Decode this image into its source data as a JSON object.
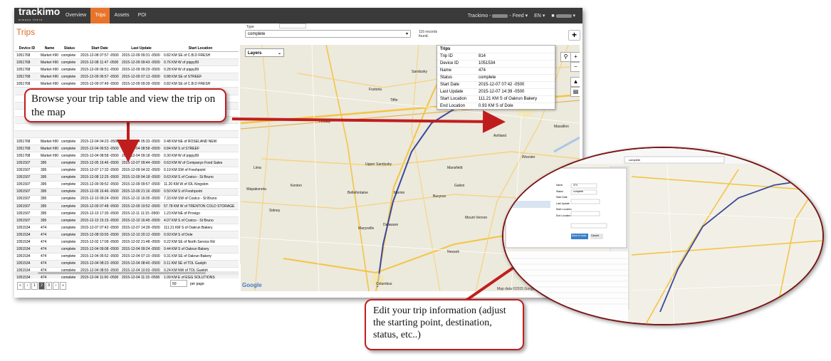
{
  "app": {
    "logo": "trackimo",
    "logo_sub": "always there",
    "nav": [
      "Overview",
      "Trips",
      "Assets",
      "POI"
    ],
    "active_nav": "Trips",
    "right_brand": "Trackimo",
    "feed_label": "Feed",
    "lang_label": "EN",
    "accent_color": "#e8742b"
  },
  "page": {
    "title": "Trips",
    "type_label": "Type",
    "status_select": "complete",
    "records": [
      "116 records",
      "found."
    ],
    "add_icon": "plus-icon"
  },
  "table": {
    "headers": [
      "Device ID",
      "Name",
      "Status",
      "Start Date",
      "Last Update",
      "Start Location"
    ],
    "rows": [
      [
        "1051768",
        "Market #90",
        "complete",
        "2015-12-08 07:57 -0500",
        "2015-12-09 09:31 -0500",
        "0.82 KM SE of C.B.D FRESH"
      ],
      [
        "1051768",
        "Market #90",
        "complete",
        "2015-12-08 11:47 -0500",
        "2015-12-09 09:43 -0500",
        "0.76 KM W of pippy99"
      ],
      [
        "1051768",
        "Market #90",
        "complete",
        "2015-12-09 06:51 -0500",
        "2015-12-09 09:29 -0500",
        "0.28 KM W of pippy99"
      ],
      [
        "1051768",
        "Market #90",
        "complete",
        "2015-12-09 06:57 -0500",
        "2015-12-09 07:13 -0500",
        "0.88 KM SE of STREEF"
      ],
      [
        "1051768",
        "Market #90",
        "complete",
        "2015-12-09 07:49 -0500",
        "2015-12-09 09:39 -0500",
        "0.82 KM SE of C.B.D FRESH"
      ],
      [
        "",
        "",
        "",
        "",
        "",
        ""
      ],
      [
        "",
        "",
        "",
        "",
        "",
        ""
      ],
      [
        "",
        "",
        "",
        "",
        "",
        ""
      ],
      [
        "",
        "",
        "",
        "",
        "",
        ""
      ],
      [
        "",
        "",
        "",
        "",
        "",
        ""
      ],
      [
        "",
        "",
        "",
        "",
        "",
        ""
      ],
      [
        "",
        "",
        "",
        "",
        "",
        ""
      ],
      [
        "1051768",
        "Market #90",
        "complete",
        "2015-12-04 04:23 -0500",
        "2015-12-04 05:33 -0500",
        "0.48 KM NE of ROSELAND NEW"
      ],
      [
        "1051768",
        "Market #90",
        "complete",
        "2015-12-04 06:53 -0500",
        "2015-12-04 08:58 -0500",
        "0.84 KM S of STREEF"
      ],
      [
        "1051768",
        "Market #90",
        "complete",
        "2015-12-04 08:58 -0500",
        "2015-12-04 09:18 -0500",
        "0.30 KM W of pippy99"
      ],
      [
        "1051507",
        "395",
        "complete",
        "2015-12-05 16:46 -0500",
        "2015-12-07 09:44 -0500",
        "0.63 KM W of Companys Food Sales"
      ],
      [
        "1051507",
        "395",
        "complete",
        "2015-12-07 17:32 -0500",
        "2015-12-09 04:32 -0500",
        "0.19 KM SW of Freshpoint"
      ],
      [
        "1051507",
        "395",
        "complete",
        "2015-12-08 12:25 -0500",
        "2015-12-09 04:18 -0500",
        "0.63 KM S of Costco - St Bruno"
      ],
      [
        "1051507",
        "395",
        "complete",
        "2015-12-09 09:52 -0500",
        "2015-12-09 09:57 -0500",
        "11.20 KM W of IDL Kingston"
      ],
      [
        "1051507",
        "395",
        "complete",
        "2015-12-09 16:46 -0500",
        "2015-12-09 21:16 -0500",
        "0.50 KM S of Freshpoint"
      ],
      [
        "1051507",
        "395",
        "complete",
        "2015-12-10 09:24 -0500",
        "2015-12-10 16:05 -0500",
        "7.33 KM SW of Costco - St Bruno"
      ],
      [
        "1051507",
        "395",
        "complete",
        "2015-12-09 07:48 -0500",
        "2015-12-09 19:52 -0500",
        "57.78 KM W of TRENTON COLD STORAGE"
      ],
      [
        "1051507",
        "395",
        "complete",
        "2015-12-10 17:30 -0500",
        "2015-12-11 11:15 -0500",
        "1.23 KM NE of Provigo"
      ],
      [
        "1051507",
        "395",
        "complete",
        "2015-12-10 15:15 -0500",
        "2015-12-10 16:45 -0500",
        "4.07 KM S of Costco - St Bruno"
      ],
      [
        "1051534",
        "474",
        "complete",
        "2015-12-07 07:42 -0500",
        "2015-12-07 14:39 -0500",
        "111.21 KM S of Oakrun Bakery"
      ],
      [
        "1051534",
        "474",
        "complete",
        "2015-12-08 03:55 -0500",
        "2015-12-10 20:12 -0500",
        "0.93 KM S of Dole"
      ],
      [
        "1051534",
        "474",
        "complete",
        "2015-12-02 17:09 -0500",
        "2015-12-02 21:48 -0500",
        "0.22 KM SE of North Service Rd"
      ],
      [
        "1051534",
        "474",
        "complete",
        "2015-12-04 09:08 -0500",
        "2015-12-04 09:24 -0500",
        "0.44 KM S of Oakrun Bakery"
      ],
      [
        "1051534",
        "474",
        "complete",
        "2015-12-04 05:52 -0500",
        "2015-12-04 07:10 -0500",
        "0.31 KM SE of Oakrun Bakery"
      ],
      [
        "1051534",
        "474",
        "complete",
        "2015-12-04 08:23 -0500",
        "2015-12-04 08:40 -0500",
        "0.11 KM SE of TDL Guelph"
      ],
      [
        "1051534",
        "474",
        "complete",
        "2015-12-04 08:50 -0500",
        "2015-12-04 10:03 -0500",
        "0.24 KM NW of TDL Guelph"
      ],
      [
        "1051534",
        "474",
        "complete",
        "2015-12-04 11:00 -0500",
        "2015-12-04 11:15 -0500",
        "1.09 KM E of EGG SOLUTIONS"
      ],
      [
        "1051534",
        "474",
        "complete",
        "2015-12-04 14:04 -0500",
        "2015-12-04 14:42 -0500",
        "0.13 KM SE of TDL Guelph"
      ]
    ]
  },
  "pager": {
    "items": [
      "«",
      "‹",
      "1",
      "2",
      "3",
      "›",
      "»"
    ],
    "current": "2",
    "per_page_value": "50",
    "per_page_label": "per page"
  },
  "map": {
    "layers_label": "Layers",
    "cities": [
      "Lima",
      "Bellefontaine",
      "Marysville",
      "Delaware",
      "Mansfield",
      "Marion",
      "Columbus",
      "Wooster",
      "Fostoria",
      "Tiffin",
      "Findlay",
      "Kenton",
      "Bucyrus",
      "Galion",
      "Ashland",
      "Upper Sandusky",
      "Mount Vernon",
      "Newark",
      "Sandusky",
      "Norwalk",
      "Sidney",
      "Wapakoneta",
      "Medina",
      "Massillon"
    ],
    "footer": "Map data ©2015 Google",
    "google": "Google",
    "trip_panel": {
      "title": "Trips",
      "fields": [
        {
          "label": "Trip ID",
          "value": "814"
        },
        {
          "label": "Device ID",
          "value": "1051534"
        },
        {
          "label": "Name",
          "value": "474"
        },
        {
          "label": "Status",
          "value": "complete"
        },
        {
          "label": "Start Date",
          "value": "2015-12-07 07:42 -0500"
        },
        {
          "label": "Last Update",
          "value": "2015-12-07 14:39 -0500"
        },
        {
          "label": "Start Location",
          "value": "111.21 KM S of Oakrun Bakery"
        },
        {
          "label": "End Location",
          "value": "0.93 KM S of Dole"
        }
      ]
    },
    "route_color": "#3a4a9c"
  },
  "callouts": {
    "browse": "Browse your trip table and view the trip on the map",
    "edit": "Edit your trip information (adjust the starting point, destination, status, etc..)",
    "arrow_color": "#c01e1e"
  },
  "zoom_inset": {
    "select_value": "complete",
    "form_labels": [
      "Name",
      "Status",
      "Start Date",
      "Last Update",
      "Start Location",
      "End Location"
    ],
    "form_values": [
      "474",
      "complete"
    ],
    "buttons": [
      "Save & close",
      "Cancel"
    ]
  }
}
